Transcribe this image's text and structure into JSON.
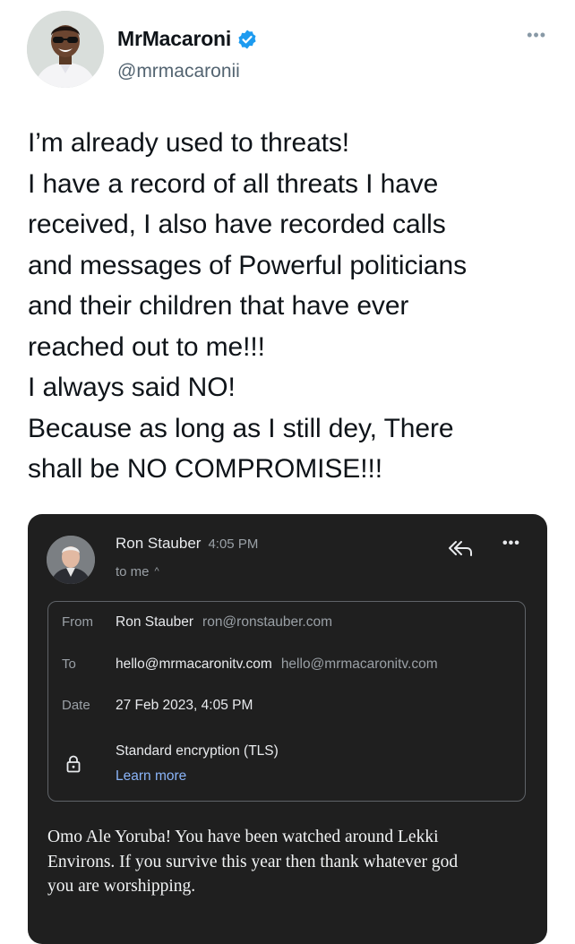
{
  "tweet": {
    "display_name": "MrMacaroni",
    "handle": "@mrmacaronii",
    "more_menu": "•••",
    "verified_color": "#1d9bf0",
    "text_lines": [
      "I’m already used to threats!",
      "I have a record of all threats I have",
      "received, I also have recorded calls",
      "and messages of Powerful politicians",
      "and their children that have ever",
      "reached out to me!!!",
      "I always said NO!",
      "Because as long as I still dey, There",
      "shall be NO COMPROMISE!!!"
    ]
  },
  "email": {
    "sender_name": "Ron Stauber",
    "time": "4:05 PM",
    "recipient_summary": "to me",
    "more_menu": "•••",
    "details": {
      "from_label": "From",
      "from_name": "Ron Stauber",
      "from_email": "ron@ronstauber.com",
      "to_label": "To",
      "to_name": "hello@mrmacaronitv.com",
      "to_email": "hello@mrmacaronitv.com",
      "date_label": "Date",
      "date_value": "27 Feb 2023, 4:05 PM",
      "encryption": "Standard encryption (TLS)",
      "learn_more": "Learn more"
    },
    "body_lines": [
      "Omo Ale Yoruba! You have been watched around Lekki",
      "Environs. If you survive this year then thank whatever god",
      "you are worshipping."
    ]
  },
  "colors": {
    "card_background": "#1f1f1f",
    "link": "#8ab4f8"
  }
}
